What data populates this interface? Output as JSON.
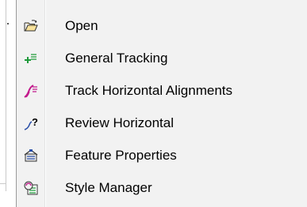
{
  "context_menu": {
    "items": [
      {
        "label": "Open",
        "icon": "open-folder-icon"
      },
      {
        "label": "General Tracking",
        "icon": "general-tracking-icon"
      },
      {
        "label": "Track Horizontal Alignments",
        "icon": "track-horizontal-icon"
      },
      {
        "label": "Review Horizontal",
        "icon": "review-horizontal-icon"
      },
      {
        "label": "Feature Properties",
        "icon": "feature-properties-icon"
      },
      {
        "label": "Style Manager",
        "icon": "style-manager-icon"
      }
    ]
  },
  "colors": {
    "menu_background": "#f2f2f2",
    "menu_border": "#9a9a9a",
    "text": "#000000",
    "icon_green": "#1f9a3a",
    "icon_magenta": "#c21a8c",
    "icon_blue": "#2a4fa8"
  }
}
